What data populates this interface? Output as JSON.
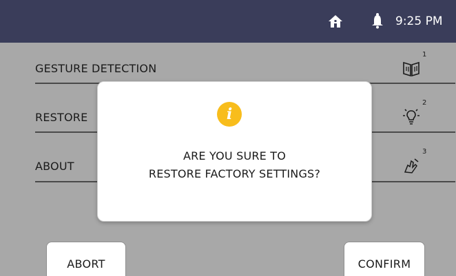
{
  "status_bar": {
    "time": "9:25 PM",
    "home_icon": "home-icon",
    "bell_icon": "bell-icon",
    "background": "#3a3d5a"
  },
  "settings": {
    "items": [
      {
        "label": "GESTURE DETECTION",
        "badge": "1",
        "icon": "gesture-book-icon"
      },
      {
        "label": "RESTORE",
        "badge": "2",
        "icon": "lightbulb-icon"
      },
      {
        "label": "ABOUT",
        "badge": "3",
        "icon": "hand-gesture-icon"
      }
    ]
  },
  "buttons": {
    "abort": "ABORT",
    "confirm": "CONFIRM"
  },
  "dialog": {
    "icon": "info-icon",
    "icon_glyph": "i",
    "line1": "ARE YOU SURE TO",
    "line2": "RESTORE FACTORY SETTINGS?",
    "accent": "#f8bd1c"
  }
}
